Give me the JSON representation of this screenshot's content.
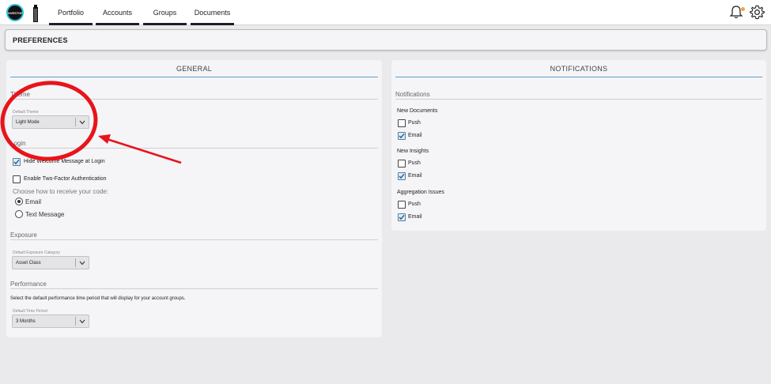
{
  "app": {
    "logo_text": "INVESTOR"
  },
  "nav": {
    "tabs": [
      {
        "label": "Portfolio"
      },
      {
        "label": "Accounts"
      },
      {
        "label": "Groups"
      },
      {
        "label": "Documents"
      }
    ]
  },
  "header": {
    "title": "PREFERENCES"
  },
  "general": {
    "title": "GENERAL",
    "theme": {
      "section_label": "Theme",
      "field_label": "Default Theme",
      "value": "Light Mode"
    },
    "login": {
      "section_label": "Login",
      "hide_welcome": {
        "label": "Hide Welcome Message at Login",
        "checked": true
      },
      "two_factor": {
        "label": "Enable Two-Factor Authentication",
        "checked": false
      },
      "receive_code_prompt": "Choose how to receive your code:",
      "options": [
        {
          "label": "Email",
          "selected": true
        },
        {
          "label": "Text Message",
          "selected": false
        }
      ]
    },
    "exposure": {
      "section_label": "Exposure",
      "field_label": "Default Exposure Category",
      "value": "Asset Class"
    },
    "performance": {
      "section_label": "Performance",
      "description": "Select the default performance time period that will display for your account groups.",
      "field_label": "Default Time Period",
      "value": "3 Months"
    }
  },
  "notifications": {
    "title": "NOTIFICATIONS",
    "section_label": "Notifications",
    "groups": [
      {
        "label": "New Documents",
        "push": {
          "label": "Push",
          "checked": false
        },
        "email": {
          "label": "Email",
          "checked": true
        }
      },
      {
        "label": "New Insights",
        "push": {
          "label": "Push",
          "checked": false
        },
        "email": {
          "label": "Email",
          "checked": true
        }
      },
      {
        "label": "Aggregation Issues",
        "push": {
          "label": "Push",
          "checked": false
        },
        "email": {
          "label": "Email",
          "checked": true
        }
      }
    ]
  },
  "colors": {
    "accent_underline": "#5b9fd0",
    "annotation": "#e8141b",
    "notification_dot": "#f4a531"
  },
  "icons": [
    "logo-icon",
    "tower-icon",
    "bell-icon",
    "gear-icon",
    "chevron-down-icon",
    "check-icon"
  ]
}
